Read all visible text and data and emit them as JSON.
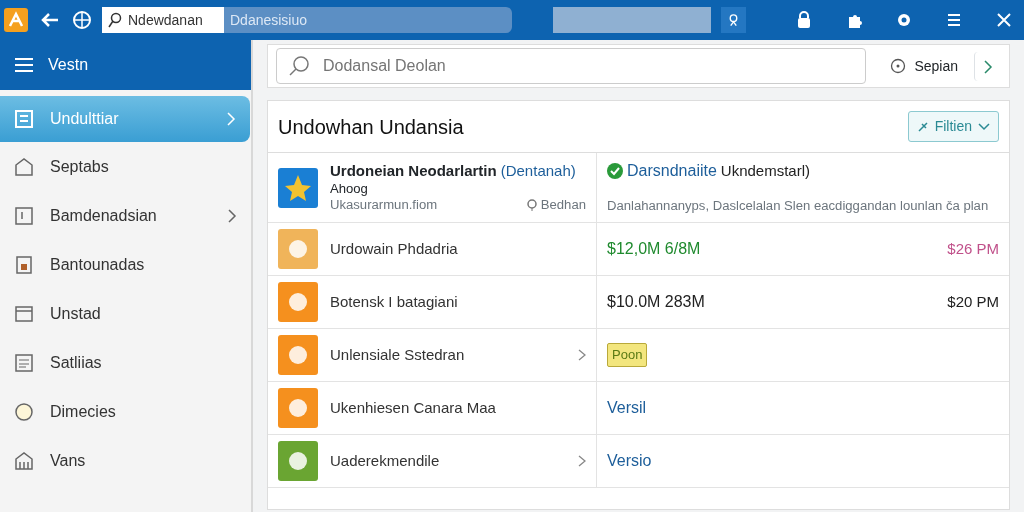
{
  "topbar": {
    "address": "Ndewdanan",
    "address_highlight": "Ddanesisiuo"
  },
  "sidebar": {
    "title": "Vestn",
    "items": [
      {
        "label": "Undulttiar",
        "selected": true,
        "arrow": true
      },
      {
        "label": "Septabs",
        "selected": false,
        "arrow": false
      },
      {
        "label": "Bamdenadsian",
        "selected": false,
        "arrow": true
      },
      {
        "label": "Bantounadas",
        "selected": false,
        "arrow": false
      },
      {
        "label": "Unstad",
        "selected": false,
        "arrow": false
      },
      {
        "label": "Satliias",
        "selected": false,
        "arrow": false
      },
      {
        "label": "Dimecies",
        "selected": false,
        "arrow": false
      },
      {
        "label": "Vans",
        "selected": false,
        "arrow": false
      }
    ]
  },
  "search": {
    "placeholder": "Dodansal Deolan",
    "action": "Sepian"
  },
  "panel": {
    "title": "Undowhan Undansia",
    "filter": "Filtien",
    "featured": {
      "title": "Urdoneian Neodarlartin",
      "link": "(Dentanah)",
      "subtitle": "Ahoog",
      "meta": "Ukasurarmun.fiom",
      "tag": "Bedhan",
      "status": "Darsndnaiite",
      "status_rest": "Ukndemstarl)",
      "description": "Danlahannanyps, Daslcelalan Slen eacdiggandan lounlan ča plan"
    },
    "rows": [
      {
        "name": "Urdowain Phdadria",
        "color": "#f0b45a",
        "arrow": false,
        "kind": "amount",
        "value": "$12,0M 6/8M",
        "time": "$26 PM",
        "highlighted": true
      },
      {
        "name": "Botensk I batagiani",
        "color": "#f5901e",
        "arrow": false,
        "kind": "amount",
        "value": "$10.0M 283M",
        "time": "$20 PM",
        "highlighted": false
      },
      {
        "name": "Unlensiale Sstedran",
        "color": "#f5901e",
        "arrow": true,
        "kind": "badge",
        "value": "Poon"
      },
      {
        "name": "Ukenhiesen Canara Maa",
        "color": "#f5901e",
        "arrow": false,
        "kind": "link",
        "value": "Versil"
      },
      {
        "name": "Uaderekmendile",
        "color": "#6aa532",
        "arrow": true,
        "kind": "link",
        "value": "Versio"
      }
    ]
  }
}
